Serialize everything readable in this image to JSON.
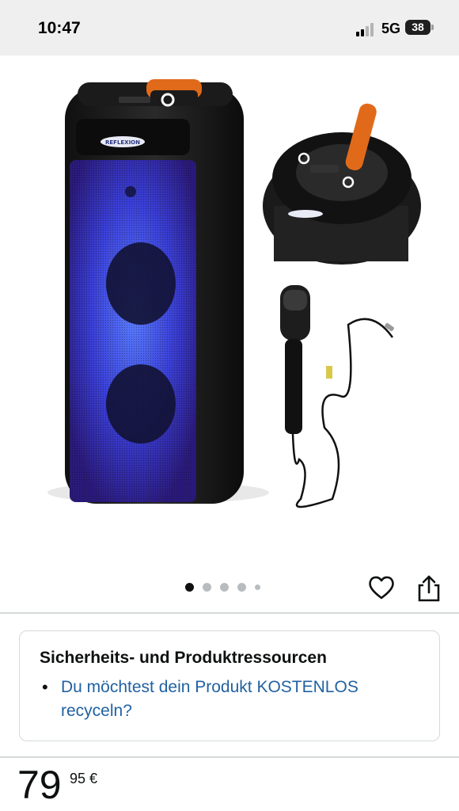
{
  "status_bar": {
    "time": "10:47",
    "network": "5G",
    "battery": "38"
  },
  "gallery": {
    "image_count": 5,
    "active_index": 0
  },
  "safety": {
    "title": "Sicherheits- und Produktressourcen",
    "link_text": "Du möchtest dein Produkt KOSTENLOS recyceln?"
  },
  "price": {
    "whole": "79",
    "fraction": "95 €"
  },
  "brand": {
    "logo_text": "REFLEXION"
  },
  "colors": {
    "link": "#2162a1",
    "text": "#0f1111",
    "divider": "#d5d9d9",
    "status_bg": "#eeefee"
  }
}
